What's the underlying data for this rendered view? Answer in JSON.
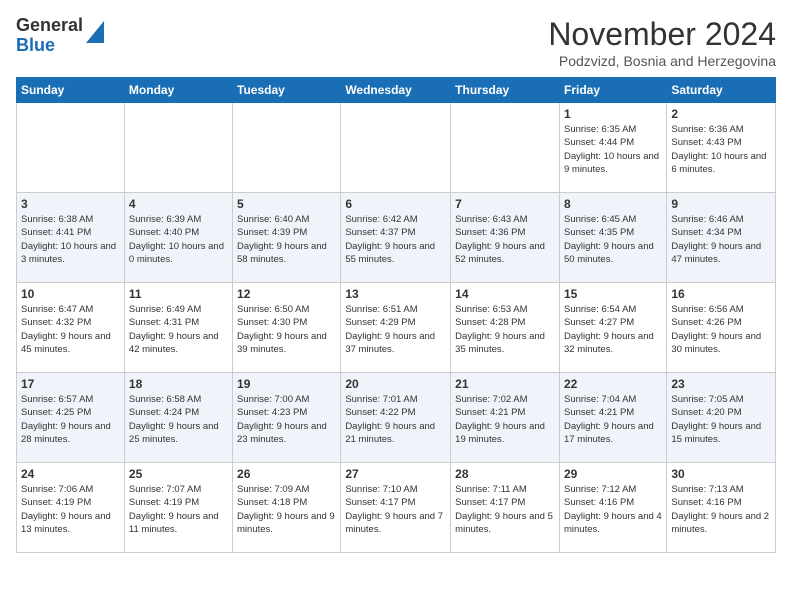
{
  "logo": {
    "general": "General",
    "blue": "Blue"
  },
  "title": "November 2024",
  "location": "Podzvizd, Bosnia and Herzegovina",
  "days_of_week": [
    "Sunday",
    "Monday",
    "Tuesday",
    "Wednesday",
    "Thursday",
    "Friday",
    "Saturday"
  ],
  "weeks": [
    [
      {
        "day": "",
        "info": ""
      },
      {
        "day": "",
        "info": ""
      },
      {
        "day": "",
        "info": ""
      },
      {
        "day": "",
        "info": ""
      },
      {
        "day": "",
        "info": ""
      },
      {
        "day": "1",
        "info": "Sunrise: 6:35 AM\nSunset: 4:44 PM\nDaylight: 10 hours and 9 minutes."
      },
      {
        "day": "2",
        "info": "Sunrise: 6:36 AM\nSunset: 4:43 PM\nDaylight: 10 hours and 6 minutes."
      }
    ],
    [
      {
        "day": "3",
        "info": "Sunrise: 6:38 AM\nSunset: 4:41 PM\nDaylight: 10 hours and 3 minutes."
      },
      {
        "day": "4",
        "info": "Sunrise: 6:39 AM\nSunset: 4:40 PM\nDaylight: 10 hours and 0 minutes."
      },
      {
        "day": "5",
        "info": "Sunrise: 6:40 AM\nSunset: 4:39 PM\nDaylight: 9 hours and 58 minutes."
      },
      {
        "day": "6",
        "info": "Sunrise: 6:42 AM\nSunset: 4:37 PM\nDaylight: 9 hours and 55 minutes."
      },
      {
        "day": "7",
        "info": "Sunrise: 6:43 AM\nSunset: 4:36 PM\nDaylight: 9 hours and 52 minutes."
      },
      {
        "day": "8",
        "info": "Sunrise: 6:45 AM\nSunset: 4:35 PM\nDaylight: 9 hours and 50 minutes."
      },
      {
        "day": "9",
        "info": "Sunrise: 6:46 AM\nSunset: 4:34 PM\nDaylight: 9 hours and 47 minutes."
      }
    ],
    [
      {
        "day": "10",
        "info": "Sunrise: 6:47 AM\nSunset: 4:32 PM\nDaylight: 9 hours and 45 minutes."
      },
      {
        "day": "11",
        "info": "Sunrise: 6:49 AM\nSunset: 4:31 PM\nDaylight: 9 hours and 42 minutes."
      },
      {
        "day": "12",
        "info": "Sunrise: 6:50 AM\nSunset: 4:30 PM\nDaylight: 9 hours and 39 minutes."
      },
      {
        "day": "13",
        "info": "Sunrise: 6:51 AM\nSunset: 4:29 PM\nDaylight: 9 hours and 37 minutes."
      },
      {
        "day": "14",
        "info": "Sunrise: 6:53 AM\nSunset: 4:28 PM\nDaylight: 9 hours and 35 minutes."
      },
      {
        "day": "15",
        "info": "Sunrise: 6:54 AM\nSunset: 4:27 PM\nDaylight: 9 hours and 32 minutes."
      },
      {
        "day": "16",
        "info": "Sunrise: 6:56 AM\nSunset: 4:26 PM\nDaylight: 9 hours and 30 minutes."
      }
    ],
    [
      {
        "day": "17",
        "info": "Sunrise: 6:57 AM\nSunset: 4:25 PM\nDaylight: 9 hours and 28 minutes."
      },
      {
        "day": "18",
        "info": "Sunrise: 6:58 AM\nSunset: 4:24 PM\nDaylight: 9 hours and 25 minutes."
      },
      {
        "day": "19",
        "info": "Sunrise: 7:00 AM\nSunset: 4:23 PM\nDaylight: 9 hours and 23 minutes."
      },
      {
        "day": "20",
        "info": "Sunrise: 7:01 AM\nSunset: 4:22 PM\nDaylight: 9 hours and 21 minutes."
      },
      {
        "day": "21",
        "info": "Sunrise: 7:02 AM\nSunset: 4:21 PM\nDaylight: 9 hours and 19 minutes."
      },
      {
        "day": "22",
        "info": "Sunrise: 7:04 AM\nSunset: 4:21 PM\nDaylight: 9 hours and 17 minutes."
      },
      {
        "day": "23",
        "info": "Sunrise: 7:05 AM\nSunset: 4:20 PM\nDaylight: 9 hours and 15 minutes."
      }
    ],
    [
      {
        "day": "24",
        "info": "Sunrise: 7:06 AM\nSunset: 4:19 PM\nDaylight: 9 hours and 13 minutes."
      },
      {
        "day": "25",
        "info": "Sunrise: 7:07 AM\nSunset: 4:19 PM\nDaylight: 9 hours and 11 minutes."
      },
      {
        "day": "26",
        "info": "Sunrise: 7:09 AM\nSunset: 4:18 PM\nDaylight: 9 hours and 9 minutes."
      },
      {
        "day": "27",
        "info": "Sunrise: 7:10 AM\nSunset: 4:17 PM\nDaylight: 9 hours and 7 minutes."
      },
      {
        "day": "28",
        "info": "Sunrise: 7:11 AM\nSunset: 4:17 PM\nDaylight: 9 hours and 5 minutes."
      },
      {
        "day": "29",
        "info": "Sunrise: 7:12 AM\nSunset: 4:16 PM\nDaylight: 9 hours and 4 minutes."
      },
      {
        "day": "30",
        "info": "Sunrise: 7:13 AM\nSunset: 4:16 PM\nDaylight: 9 hours and 2 minutes."
      }
    ]
  ]
}
